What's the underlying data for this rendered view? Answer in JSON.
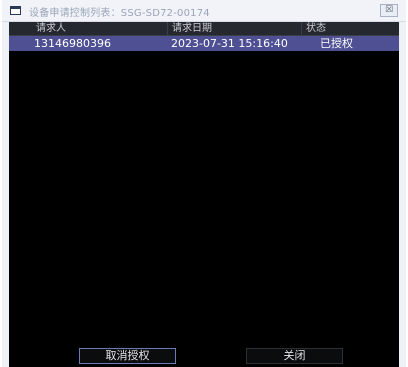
{
  "window": {
    "title": "设备申请控制列表：SSG-SD72-00174",
    "close_label": "☒"
  },
  "table": {
    "columns": [
      "请求人",
      "请求日期",
      "状态"
    ],
    "rows": [
      {
        "requester": "13146980396",
        "date": "2023-07-31 15:16:40",
        "status": "已授权"
      }
    ]
  },
  "buttons": {
    "cancel_auth": "取消授权",
    "close": "关闭"
  }
}
